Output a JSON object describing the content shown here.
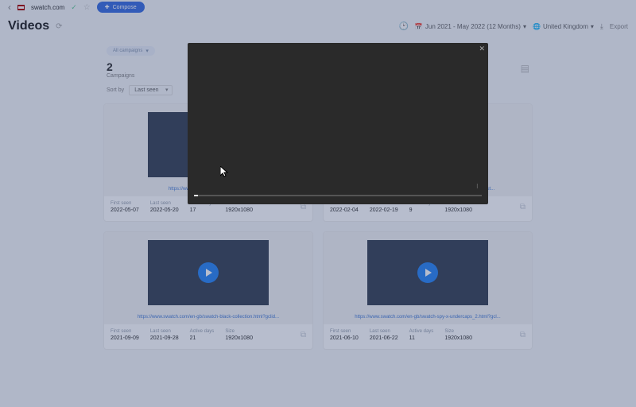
{
  "top": {
    "domain": "swatch.com",
    "compose": "Compose"
  },
  "page": {
    "title": "Videos",
    "date_range": "Jun 2021 - May 2022 (12 Months)",
    "country": "United Kingdom",
    "export": "Export"
  },
  "filters": {
    "chip": "All campaigns",
    "total_count": "2",
    "total_label": "Campaigns",
    "sort_label": "Sort by",
    "sort_value": "Last seen"
  },
  "labels": {
    "first_seen": "First seen",
    "last_seen": "Last seen",
    "active_days": "Active days",
    "size": "Size"
  },
  "cards": [
    {
      "url": "https://www.swatch.com/en-gb/swat...",
      "first": "2022-05-07",
      "last": "2022-05-20",
      "days": "17",
      "size": "1920x1080"
    },
    {
      "url": "https://www.swatch.com/en-gb/swatch-x-centre-pompidou/?ut...",
      "first": "2022-02-04",
      "last": "2022-02-19",
      "days": "9",
      "size": "1920x1080"
    },
    {
      "url": "https://www.swatch.com/en-gb/swatch-black-collection.html?gclid...",
      "first": "2021-09-09",
      "last": "2021-09-28",
      "days": "21",
      "size": "1920x1080"
    },
    {
      "url": "https://www.swatch.com/en-gb/swatch-spy-x-undercaps_2.html?gcl...",
      "first": "2021-06-10",
      "last": "2021-06-22",
      "days": "11",
      "size": "1920x1080"
    }
  ]
}
